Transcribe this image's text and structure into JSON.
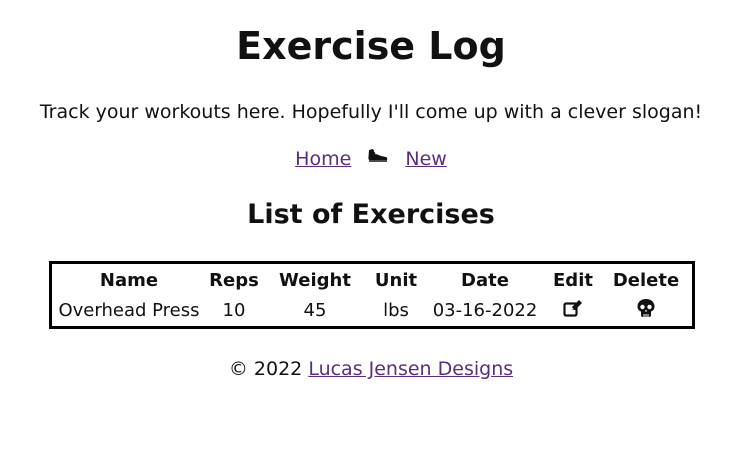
{
  "header": {
    "title": "Exercise Log",
    "slogan": "Track your workouts here. Hopefully I'll come up with a clever slogan!"
  },
  "nav": {
    "home_label": "Home",
    "new_label": "New",
    "separator_icon": "shoe-icon"
  },
  "main": {
    "heading": "List of Exercises",
    "table": {
      "columns": [
        "Name",
        "Reps",
        "Weight",
        "Unit",
        "Date",
        "Edit",
        "Delete"
      ],
      "rows": [
        {
          "name": "Overhead Press",
          "reps": "10",
          "weight": "45",
          "unit": "lbs",
          "date": "03-16-2022",
          "edit_icon": "edit-icon",
          "delete_icon": "skull-icon"
        }
      ]
    }
  },
  "footer": {
    "copyright": "© 2022",
    "link_label": "Lucas Jensen Designs"
  },
  "colors": {
    "link": "#5a2d82",
    "text": "#111111",
    "border": "#000000"
  }
}
